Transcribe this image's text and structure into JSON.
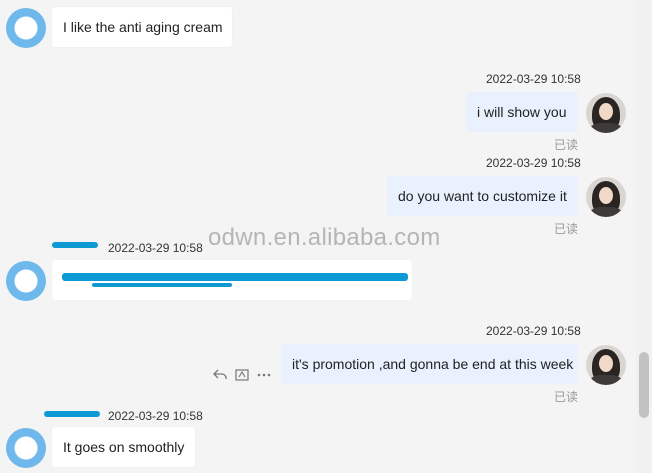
{
  "messages": [
    {
      "direction": "in",
      "text": "I like the anti aging cream"
    },
    {
      "direction": "out",
      "timestamp": "2022-03-29 10:58",
      "text": "i will show you",
      "status": "已读"
    },
    {
      "direction": "out",
      "timestamp": "2022-03-29 10:58",
      "text": "do you want to customize it",
      "status": "已读"
    },
    {
      "direction": "in",
      "timestamp": "2022-03-29 10:58",
      "text": ""
    },
    {
      "direction": "out",
      "timestamp": "2022-03-29 10:58",
      "text": "it's promotion ,and gonna be end at this week",
      "status": "已读"
    },
    {
      "direction": "in",
      "timestamp": "2022-03-29 10:58",
      "text": "It goes on smoothly"
    }
  ],
  "watermark": "odwn.en.alibaba.com",
  "icons": {
    "reply": "reply-icon",
    "translate": "translate-icon",
    "more": "more-icon"
  },
  "colors": {
    "incoming_bubble": "#ffffff",
    "outgoing_bubble": "#e8f1fd",
    "redaction": "#0d9ad4",
    "avatar_blue": "#6fb8ec"
  }
}
